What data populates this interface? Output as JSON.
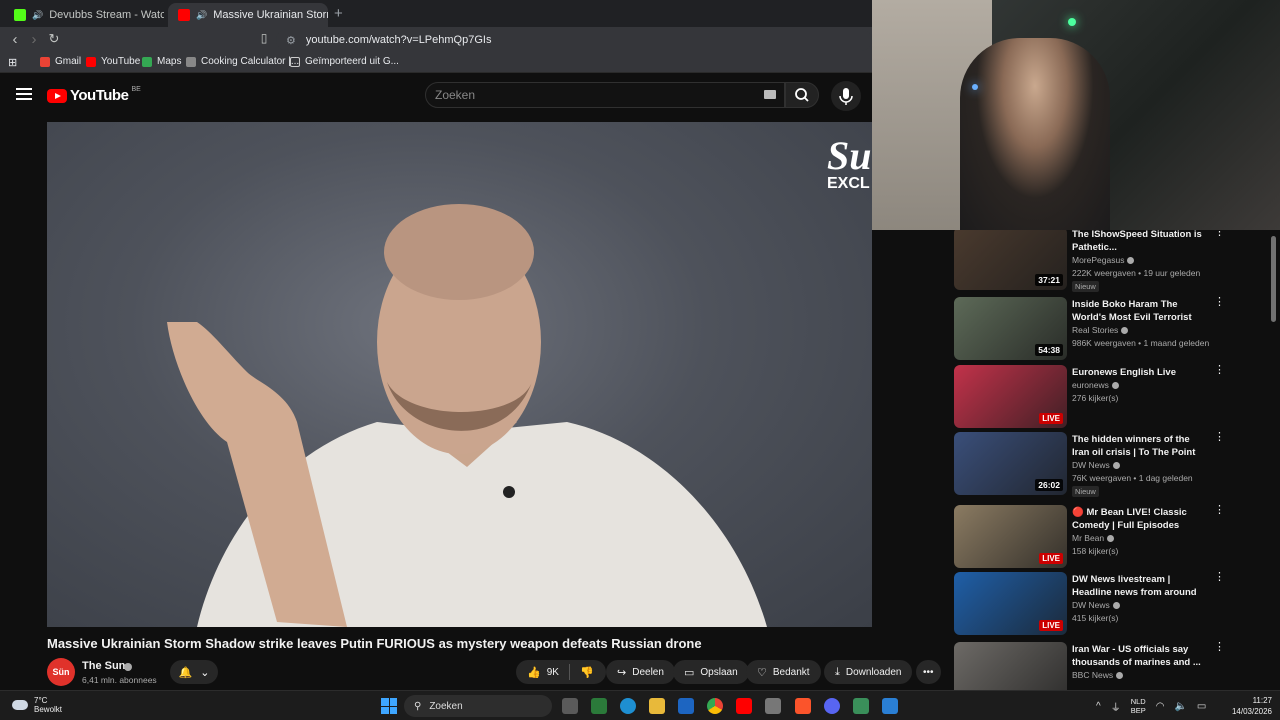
{
  "browser": {
    "tabs": [
      {
        "label": "Devubbs Stream - Watch Live on",
        "favicon_color": "#53fc18"
      },
      {
        "label": "Massive Ukrainian Storm Sha",
        "favicon_color": "#ff0000"
      }
    ],
    "new_tab": "+",
    "close_glyph": "×",
    "url": "youtube.com/watch?v=LPehmQp7GIs",
    "bookmarks": [
      {
        "label": "Gmail",
        "color": "#ea4335"
      },
      {
        "label": "YouTube",
        "color": "#ff0000"
      },
      {
        "label": "Maps",
        "color": "#34a853"
      },
      {
        "label": "Cooking Calculator |...",
        "color": "#888888"
      },
      {
        "label": "Geïmporteerd uit G...",
        "color": "#888888"
      }
    ]
  },
  "youtube": {
    "logo_text": "YouTube",
    "country": "BE",
    "search_placeholder": "Zoeken"
  },
  "video": {
    "watermark_big": "Su",
    "watermark_small": "EXCL",
    "badge": "S",
    "title": "Massive Ukrainian Storm Shadow strike leaves Putin FURIOUS as mystery weapon defeats Russian drone",
    "channel": {
      "avatar_text": "Sün",
      "name": "The Sun",
      "subscribers": "6,41 mln. abonnees"
    },
    "actions": {
      "likes": "9K",
      "share": "Deelen",
      "save": "Opslaan",
      "thanks": "Bedankt",
      "download": "Downloaden",
      "more": "•••"
    }
  },
  "recommendations": [
    {
      "title": "The IShowSpeed Situation is Pathetic...",
      "channel": "MorePegasus",
      "meta": "222K weergaven • 19 uur geleden",
      "badge": "Nieuw",
      "duration": "37:21",
      "thumb": "#4a3a2e"
    },
    {
      "title": "Inside Boko Haram The World's Most Evil Terrorist Group",
      "channel": "Real Stories",
      "meta": "986K weergaven • 1 maand geleden",
      "badge": "",
      "duration": "54:38",
      "thumb": "#5d6a58"
    },
    {
      "title": "Euronews English Live",
      "channel": "euronews",
      "meta": "276 kijker(s)",
      "badge": "",
      "duration": "LIVE",
      "thumb": "#c2324a"
    },
    {
      "title": "The hidden winners of the Iran oil crisis | To The Point",
      "channel": "DW News",
      "meta": "76K weergaven • 1 dag geleden",
      "badge": "Nieuw",
      "duration": "26:02",
      "thumb": "#3a4f7a"
    },
    {
      "title": "🔴 Mr Bean LIVE! Classic Comedy | Full Episodes",
      "channel": "Mr Bean",
      "meta": "158 kijker(s)",
      "badge": "",
      "duration": "LIVE",
      "thumb": "#8b7b62"
    },
    {
      "title": "DW News livestream | Headline news from around the world",
      "channel": "DW News",
      "meta": "415 kijker(s)",
      "badge": "",
      "duration": "LIVE",
      "thumb": "#1f5fa8"
    },
    {
      "title": "Iran War - US officials say thousands of marines and ...",
      "channel": "BBC News",
      "meta": "",
      "badge": "",
      "duration": "",
      "thumb": "#6d6a66"
    }
  ],
  "taskbar": {
    "weather_temp": "7°C",
    "weather_desc": "Bewolkt",
    "search": "Zoeken",
    "lang_1": "NLD",
    "lang_2": "BEP",
    "time": "11:27",
    "date": "14/03/2026"
  }
}
